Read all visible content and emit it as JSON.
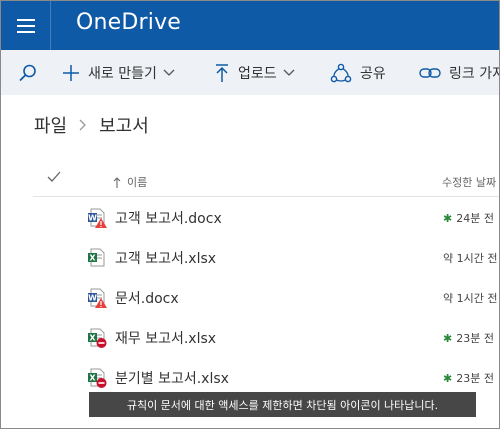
{
  "header": {
    "app_title": "OneDrive",
    "menu_icon": "hamburger-menu-icon",
    "brand_color": "#0f5aa6"
  },
  "commands": {
    "search_icon": "search-icon",
    "new_label": "새로 만들기",
    "upload_label": "업로드",
    "share_label": "공유",
    "link_label": "링크 가져오기"
  },
  "breadcrumb": {
    "root": "파일",
    "current": "보고서"
  },
  "list": {
    "columns": {
      "name": "이름",
      "modified": "수정한 날짜"
    },
    "files": [
      {
        "name": "고객 보고서.docx",
        "type": "word",
        "status": "warning",
        "modified": "24분 전",
        "recent": true
      },
      {
        "name": "고객 보고서.xlsx",
        "type": "excel",
        "status": "none",
        "modified": "약 1시간 전",
        "recent": false
      },
      {
        "name": "문서.docx",
        "type": "word",
        "status": "warning",
        "modified": "약 1시간 전",
        "recent": false
      },
      {
        "name": "재무 보고서.xlsx",
        "type": "excel",
        "status": "blocked",
        "modified": "23분 전",
        "recent": true
      },
      {
        "name": "분기별 보고서.xlsx",
        "type": "excel",
        "status": "blocked",
        "modified": "23분 전",
        "recent": true
      }
    ]
  },
  "tooltip": {
    "text": "규칙이 문서에 대한 액세스를 제한하면 차단됨 아이콘이 나타납니다."
  }
}
